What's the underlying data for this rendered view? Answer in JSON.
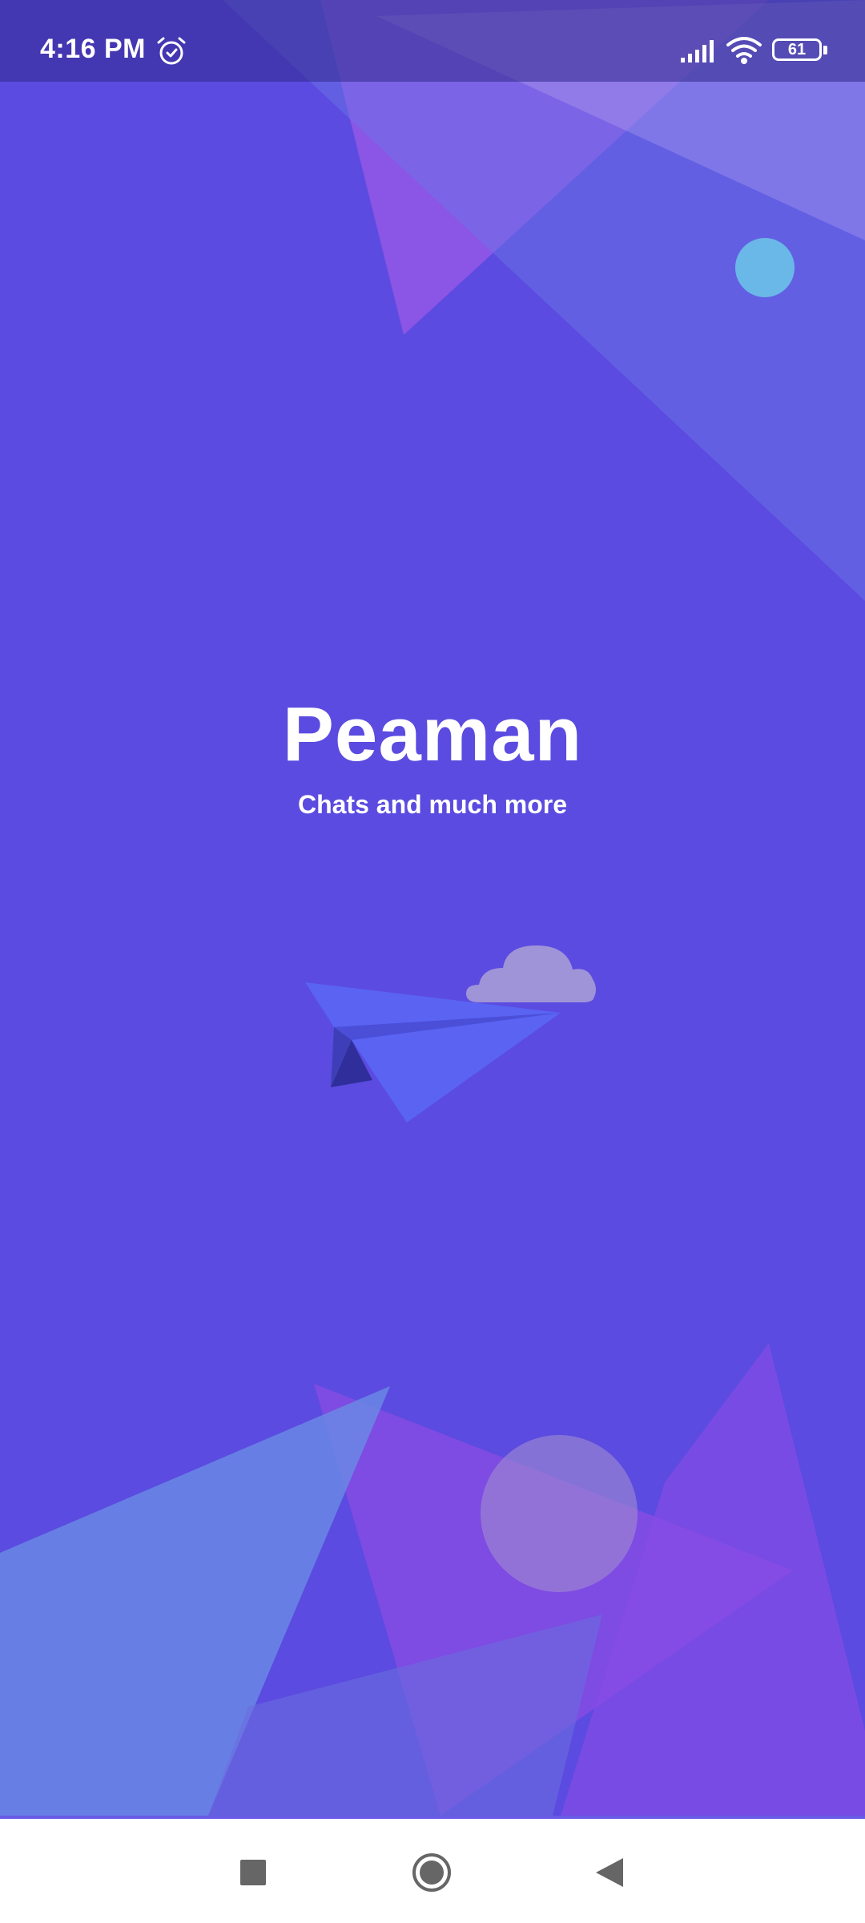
{
  "status_bar": {
    "time": "4:16 PM",
    "battery_level": "61",
    "icons": [
      "alarm-icon",
      "signal-icon",
      "wifi-icon",
      "battery-icon"
    ]
  },
  "splash": {
    "title": "Peaman",
    "subtitle": "Chats and much more",
    "illustration": [
      "paper-plane-icon",
      "cloud-icon"
    ]
  },
  "nav_bar": {
    "buttons": [
      "recents-button",
      "home-button",
      "back-button"
    ]
  },
  "colors": {
    "background": "#5b4be0",
    "status_bar": "#3f36a8",
    "accent_cyan": "#6ab8e8",
    "plane_blue": "#5a63f2",
    "cloud": "#9f94d8",
    "nav_bar": "#ffffff"
  }
}
